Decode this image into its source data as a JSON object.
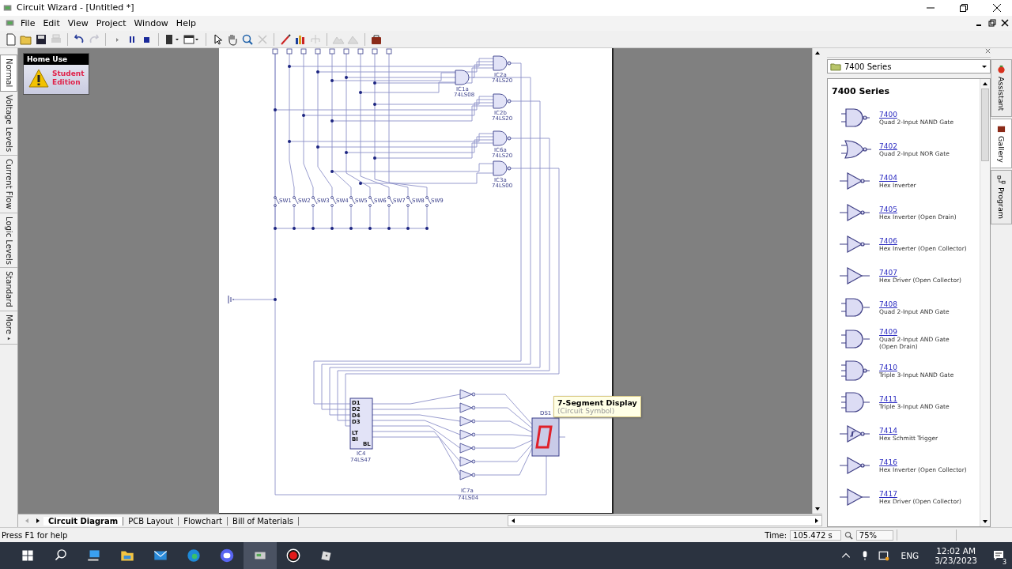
{
  "window": {
    "title": "Circuit Wizard - [Untitled *]"
  },
  "menu": [
    "File",
    "Edit",
    "View",
    "Project",
    "Window",
    "Help"
  ],
  "view_tabs": [
    {
      "label": "Normal",
      "selected": true
    },
    {
      "label": "Voltage Levels",
      "selected": false
    },
    {
      "label": "Current Flow",
      "selected": false
    },
    {
      "label": "Logic Levels",
      "selected": false
    },
    {
      "label": "Standard",
      "selected": false
    },
    {
      "label": "More",
      "selected": false
    }
  ],
  "edition_card": {
    "header": "Home Use",
    "text": "Student Edition"
  },
  "circuit": {
    "switches": [
      "SW1",
      "SW2",
      "SW3",
      "SW4",
      "SW5",
      "SW6",
      "SW7",
      "SW8",
      "SW9"
    ],
    "gates": [
      {
        "kind": "nand",
        "label": "IC2a",
        "part": "74LS20"
      },
      {
        "kind": "and",
        "label": "IC1a",
        "part": "74LS08"
      },
      {
        "kind": "nand",
        "label": "IC2b",
        "part": "74LS20"
      },
      {
        "kind": "nand",
        "label": "IC6a",
        "part": "74LS20"
      },
      {
        "kind": "nand",
        "label": "IC3a",
        "part": "74LS00"
      }
    ],
    "decoder": {
      "label": "IC4",
      "part": "74LS47",
      "pins_left": [
        "D1",
        "D2",
        "D4",
        "D3",
        "LT",
        "BI"
      ],
      "pin_right": "BL"
    },
    "inverter": {
      "label": "IC7a",
      "part": "74LS04"
    },
    "display": {
      "label": "DS1"
    },
    "tooltip": {
      "title": "7-Segment Display",
      "subtitle": "(Circuit Symbol)"
    }
  },
  "doc_tabs": [
    {
      "label": "Circuit Diagram",
      "selected": true
    },
    {
      "label": "PCB Layout",
      "selected": false
    },
    {
      "label": "Flowchart",
      "selected": false
    },
    {
      "label": "Bill of Materials",
      "selected": false
    }
  ],
  "gallery": {
    "folder": "7400 Series",
    "heading": "7400 Series",
    "items": [
      {
        "kind": "nand",
        "number": "7400",
        "desc": [
          "Quad 2-Input NAND Gate"
        ]
      },
      {
        "kind": "nor",
        "number": "7402",
        "desc": [
          "Quad 2-Input NOR Gate"
        ]
      },
      {
        "kind": "not",
        "number": "7404",
        "desc": [
          "Hex Inverter"
        ]
      },
      {
        "kind": "not",
        "number": "7405",
        "desc": [
          "Hex Inverter (Open Drain)"
        ]
      },
      {
        "kind": "not",
        "number": "7406",
        "desc": [
          "Hex Inverter (Open Collector)"
        ]
      },
      {
        "kind": "buffer",
        "number": "7407",
        "desc": [
          "Hex Driver (Open Collector)"
        ]
      },
      {
        "kind": "and",
        "number": "7408",
        "desc": [
          "Quad 2-Input AND Gate"
        ]
      },
      {
        "kind": "and",
        "number": "7409",
        "desc": [
          "Quad 2-Input AND Gate",
          "(Open Drain)"
        ]
      },
      {
        "kind": "nand3",
        "number": "7410",
        "desc": [
          "Triple 3-Input NAND Gate"
        ]
      },
      {
        "kind": "and3",
        "number": "7411",
        "desc": [
          "Triple 3-Input AND Gate"
        ]
      },
      {
        "kind": "schmitt",
        "number": "7414",
        "desc": [
          "Hex Schmitt Trigger"
        ]
      },
      {
        "kind": "not",
        "number": "7416",
        "desc": [
          "Hex Inverter (Open Collector)"
        ]
      },
      {
        "kind": "buffer",
        "number": "7417",
        "desc": [
          "Hex Driver (Open Collector)"
        ]
      }
    ]
  },
  "side_tabs": [
    {
      "label": "Assistant",
      "selected": false
    },
    {
      "label": "Gallery",
      "selected": true
    },
    {
      "label": "Program",
      "selected": false
    }
  ],
  "status_bar": {
    "help": "Press F1 for help",
    "time_label": "Time:",
    "time": "105.472 s",
    "zoom": "75%"
  },
  "taskbar": {
    "language": "ENG",
    "time": "12:02 AM",
    "date": "3/23/2023",
    "notifications": "3"
  }
}
